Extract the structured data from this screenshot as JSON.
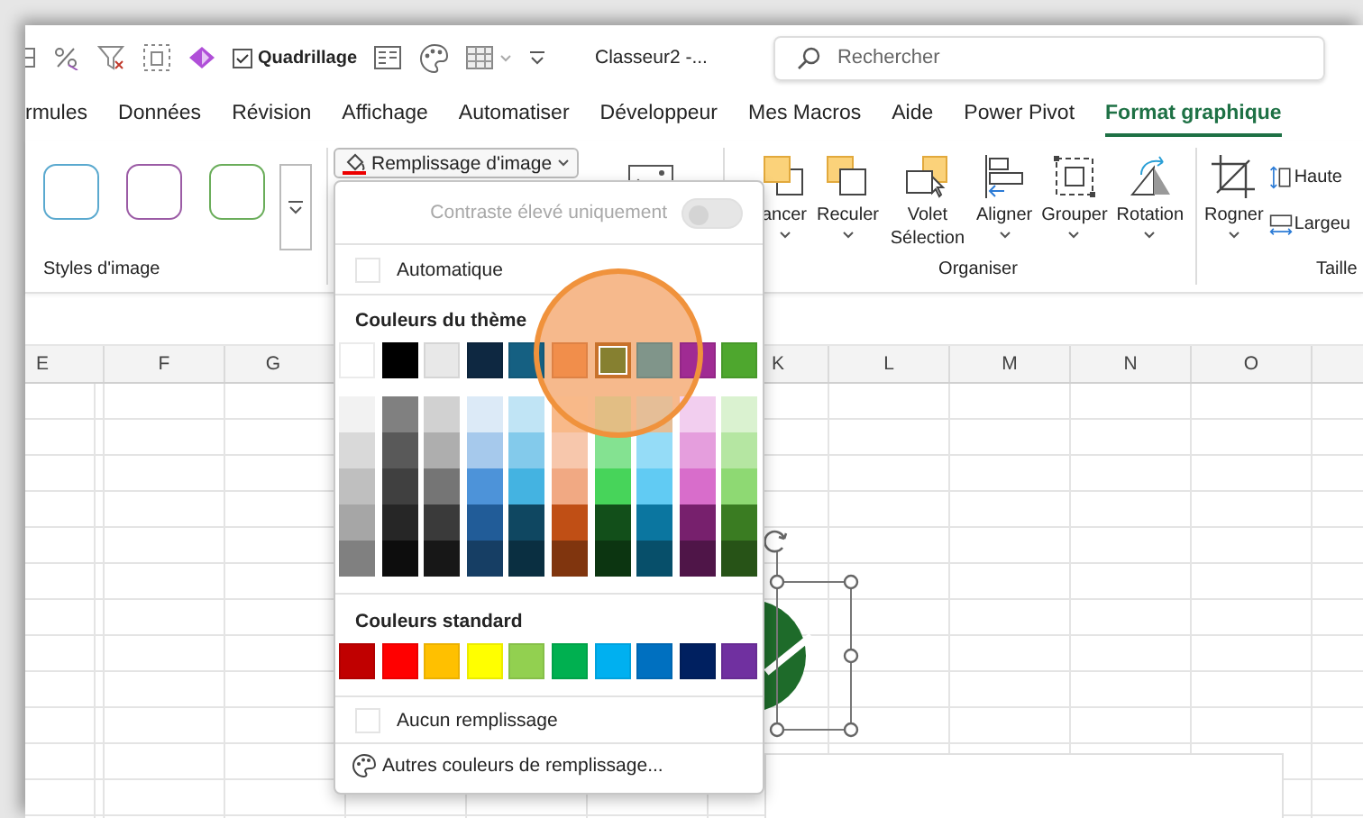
{
  "quick_access": {
    "gridlines_checkbox": {
      "label": "Quadrillage",
      "checked": true
    },
    "document_title": "Classeur2 -...",
    "search": {
      "placeholder": "Rechercher"
    }
  },
  "tabs": [
    {
      "label": "rmules",
      "selected": false
    },
    {
      "label": "Données",
      "selected": false
    },
    {
      "label": "Révision",
      "selected": false
    },
    {
      "label": "Affichage",
      "selected": false
    },
    {
      "label": "Automatiser",
      "selected": false
    },
    {
      "label": "Développeur",
      "selected": false
    },
    {
      "label": "Mes Macros",
      "selected": false
    },
    {
      "label": "Aide",
      "selected": false
    },
    {
      "label": "Power Pivot",
      "selected": false
    },
    {
      "label": "Format graphique",
      "selected": true
    }
  ],
  "ribbon": {
    "styles_group": {
      "label": "Styles d'image",
      "styles": [
        {
          "color": "#5aa9cf"
        },
        {
          "color": "#9b5ba5"
        },
        {
          "color": "#6aad5a"
        }
      ]
    },
    "fill_button": {
      "label": "Remplissage d'image"
    },
    "arrange_group": {
      "label": "Organiser",
      "buttons": [
        {
          "label": "ancer",
          "kind": "bring-forward"
        },
        {
          "label": "Reculer",
          "kind": "send-backward"
        },
        {
          "label": "Volet Sélection",
          "kind": "selection-pane"
        },
        {
          "label": "Aligner",
          "kind": "align"
        },
        {
          "label": "Grouper",
          "kind": "group"
        },
        {
          "label": "Rotation",
          "kind": "rotate"
        }
      ]
    },
    "size_group": {
      "label": "Taille",
      "crop": {
        "label": "Rogner"
      },
      "fields": [
        {
          "label": "Haute",
          "kind": "height"
        },
        {
          "label": "Largeu",
          "kind": "width"
        }
      ]
    }
  },
  "column_headers": {
    "left": [
      "E",
      "F",
      "G"
    ],
    "right": [
      "K",
      "L",
      "M",
      "N",
      "O"
    ]
  },
  "fill_menu": {
    "contrast_toggle": {
      "label": "Contraste élevé uniquement",
      "on": false,
      "disabled": true
    },
    "automatic": {
      "label": "Automatique"
    },
    "theme_colors": {
      "heading": "Couleurs du thème",
      "top": [
        {
          "color": "#ffffff",
          "selected": false
        },
        {
          "color": "#000000",
          "selected": false
        },
        {
          "color": "#e8e8e8",
          "selected": false
        },
        {
          "color": "#0e2841",
          "selected": false
        },
        {
          "color": "#156082",
          "selected": false
        },
        {
          "color": "#f18e4b",
          "selected": false
        },
        {
          "color": "#868030",
          "selected": true
        },
        {
          "color": "#80958a",
          "selected": false
        },
        {
          "color": "#a02b93",
          "selected": false
        },
        {
          "color": "#4ea72e",
          "selected": false
        }
      ],
      "shades": [
        [
          {
            "color": "#f2f2f2",
            "selected": false
          },
          {
            "color": "#d9d9d9",
            "selected": false
          },
          {
            "color": "#bfbfbf",
            "selected": false
          },
          {
            "color": "#a6a6a6",
            "selected": false
          },
          {
            "color": "#808080",
            "selected": false
          }
        ],
        [
          {
            "color": "#808080",
            "selected": false
          },
          {
            "color": "#595959",
            "selected": false
          },
          {
            "color": "#404040",
            "selected": false
          },
          {
            "color": "#262626",
            "selected": false
          },
          {
            "color": "#0d0d0d",
            "selected": false
          }
        ],
        [
          {
            "color": "#d1d1d1",
            "selected": false
          },
          {
            "color": "#aeaeae",
            "selected": false
          },
          {
            "color": "#757575",
            "selected": false
          },
          {
            "color": "#3a3a3a",
            "selected": false
          },
          {
            "color": "#171717",
            "selected": false
          }
        ],
        [
          {
            "color": "#dceaf7",
            "selected": false
          },
          {
            "color": "#a6c9ec",
            "selected": false
          },
          {
            "color": "#4d93d9",
            "selected": false
          },
          {
            "color": "#215c98",
            "selected": false
          },
          {
            "color": "#163e64",
            "selected": false
          }
        ],
        [
          {
            "color": "#c0e4f5",
            "selected": false
          },
          {
            "color": "#83caeb",
            "selected": false
          },
          {
            "color": "#44b3e1",
            "selected": false
          },
          {
            "color": "#0f4761",
            "selected": false
          },
          {
            "color": "#0a2f41",
            "selected": false
          }
        ],
        [
          {
            "color": "#f8b989",
            "selected": false
          },
          {
            "color": "#f7c7ac",
            "selected": false
          },
          {
            "color": "#f1a983",
            "selected": false
          },
          {
            "color": "#c04f15",
            "selected": false
          },
          {
            "color": "#80350e",
            "selected": false
          }
        ],
        [
          {
            "color": "#e2be84",
            "selected": false
          },
          {
            "color": "#84e291",
            "selected": false
          },
          {
            "color": "#47d45a",
            "selected": false
          },
          {
            "color": "#124f1a",
            "selected": false
          },
          {
            "color": "#0c3511",
            "selected": false
          }
        ],
        [
          {
            "color": "#e5be97",
            "selected": false
          },
          {
            "color": "#95dcf7",
            "selected": false
          },
          {
            "color": "#61cbf3",
            "selected": false
          },
          {
            "color": "#0b76a0",
            "selected": false
          },
          {
            "color": "#074f6a",
            "selected": false
          }
        ],
        [
          {
            "color": "#f2ceef",
            "selected": false
          },
          {
            "color": "#e59edd",
            "selected": false
          },
          {
            "color": "#d86dcb",
            "selected": false
          },
          {
            "color": "#77206d",
            "selected": false
          },
          {
            "color": "#4f1548",
            "selected": false
          }
        ],
        [
          {
            "color": "#daf2d0",
            "selected": false
          },
          {
            "color": "#b5e6a2",
            "selected": false
          },
          {
            "color": "#8ed973",
            "selected": false
          },
          {
            "color": "#3a7c22",
            "selected": false
          },
          {
            "color": "#275317",
            "selected": false
          }
        ]
      ]
    },
    "standard_colors": {
      "heading": "Couleurs standard",
      "swatches": [
        {
          "color": "#c00000",
          "selected": false
        },
        {
          "color": "#ff0000",
          "selected": false
        },
        {
          "color": "#ffc000",
          "selected": false
        },
        {
          "color": "#ffff00",
          "selected": false
        },
        {
          "color": "#92d050",
          "selected": false
        },
        {
          "color": "#00b050",
          "selected": false
        },
        {
          "color": "#00b0f0",
          "selected": false
        },
        {
          "color": "#0070c0",
          "selected": false
        },
        {
          "color": "#002060",
          "selected": false
        },
        {
          "color": "#7030a0",
          "selected": false
        }
      ]
    },
    "no_fill": {
      "label": "Aucun remplissage"
    },
    "more_colors": {
      "label": "Autres couleurs de remplissage..."
    }
  }
}
